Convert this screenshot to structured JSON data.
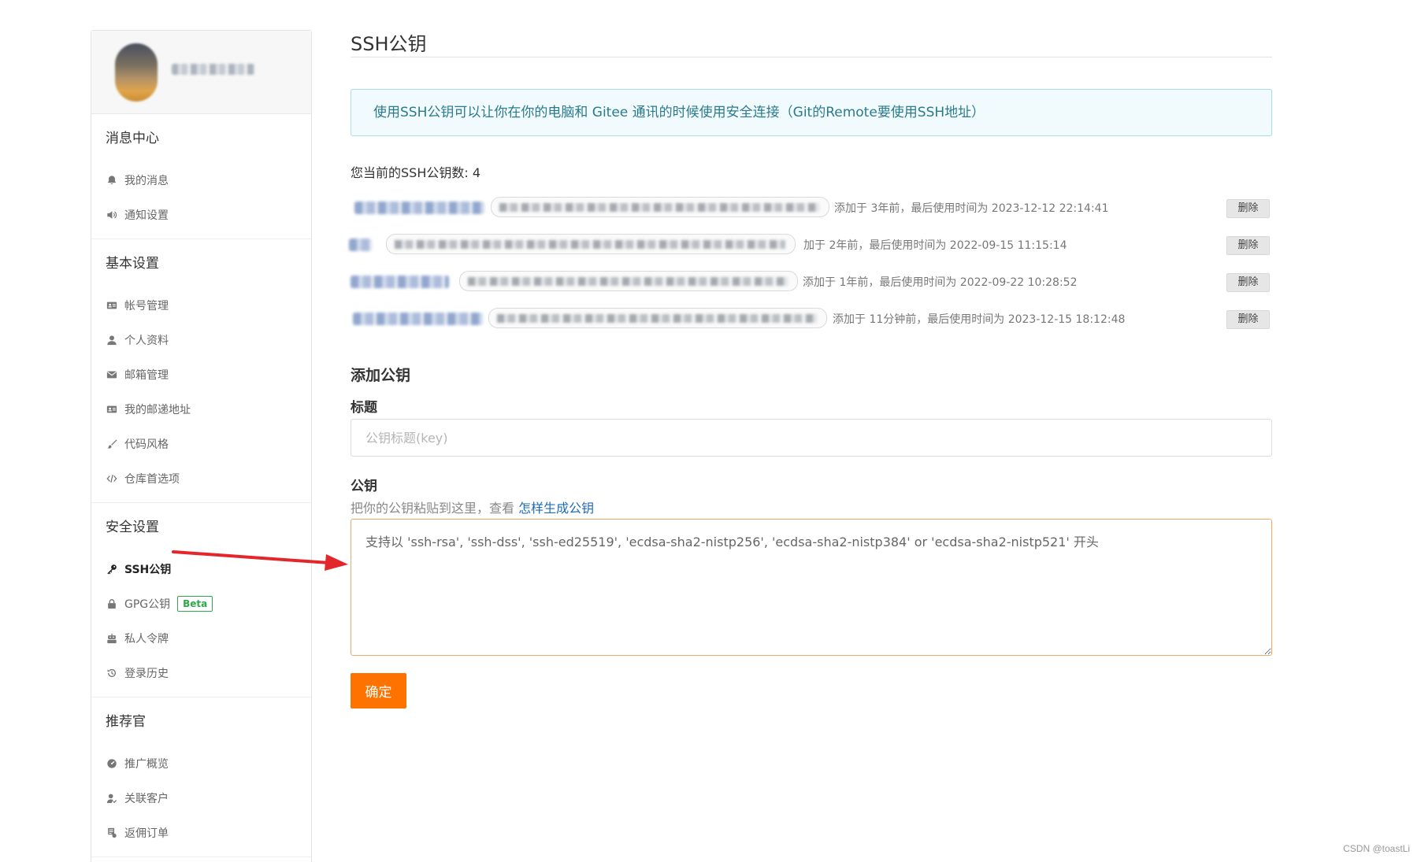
{
  "sidebar": {
    "groups": [
      {
        "title": "消息中心",
        "items": [
          {
            "label": "我的消息",
            "icon": "bell-icon"
          },
          {
            "label": "通知设置",
            "icon": "speaker-icon"
          }
        ]
      },
      {
        "title": "基本设置",
        "items": [
          {
            "label": "帐号管理",
            "icon": "id-card-icon"
          },
          {
            "label": "个人资料",
            "icon": "user-icon"
          },
          {
            "label": "邮箱管理",
            "icon": "envelope-icon"
          },
          {
            "label": "我的邮递地址",
            "icon": "address-card-icon"
          },
          {
            "label": "代码风格",
            "icon": "brush-icon"
          },
          {
            "label": "仓库首选项",
            "icon": "code-icon"
          }
        ]
      },
      {
        "title": "安全设置",
        "items": [
          {
            "label": "SSH公钥",
            "icon": "key-icon",
            "active": true
          },
          {
            "label": "GPG公钥",
            "icon": "lock-icon",
            "badge": "Beta"
          },
          {
            "label": "私人令牌",
            "icon": "robot-icon"
          },
          {
            "label": "登录历史",
            "icon": "history-icon"
          }
        ]
      },
      {
        "title": "推荐官",
        "items": [
          {
            "label": "推广概览",
            "icon": "dashboard-icon"
          },
          {
            "label": "关联客户",
            "icon": "user-link-icon"
          },
          {
            "label": "返佣订单",
            "icon": "receipt-icon"
          }
        ]
      }
    ]
  },
  "main": {
    "title": "SSH公钥",
    "info": "使用SSH公钥可以让你在你的电脑和 Gitee 通讯的时候使用安全连接（Git的Remote要使用SSH地址）",
    "key_count_label": "您当前的SSH公钥数: 4",
    "keys": [
      {
        "meta": "添加于 3年前，最后使用时间为 2023-12-12 22:14:41",
        "delete_label": "删除"
      },
      {
        "meta": "加于 2年前，最后使用时间为 2022-09-15 11:15:14",
        "delete_label": "删除"
      },
      {
        "meta": "添加于 1年前，最后使用时间为 2022-09-22 10:28:52",
        "delete_label": "删除"
      },
      {
        "meta": "添加于 11分钟前，最后使用时间为 2023-12-15 18:12:48",
        "delete_label": "删除"
      }
    ],
    "add_title": "添加公钥",
    "title_label": "标题",
    "title_placeholder": "公钥标题(key)",
    "key_label": "公钥",
    "key_hint": "把你的公钥粘贴到这里，查看 ",
    "key_hint_link": "怎样生成公钥",
    "key_placeholder": "支持以 'ssh-rsa', 'ssh-dss', 'ssh-ed25519', 'ecdsa-sha2-nistp256', 'ecdsa-sha2-nistp384' or 'ecdsa-sha2-nistp521' 开头",
    "submit_label": "确定"
  },
  "watermark": "CSDN @toastLi",
  "colors": {
    "accent": "#fe7300",
    "info_border": "#a8dee3",
    "link": "#1e6bb8",
    "arrow": "#e3262a"
  }
}
